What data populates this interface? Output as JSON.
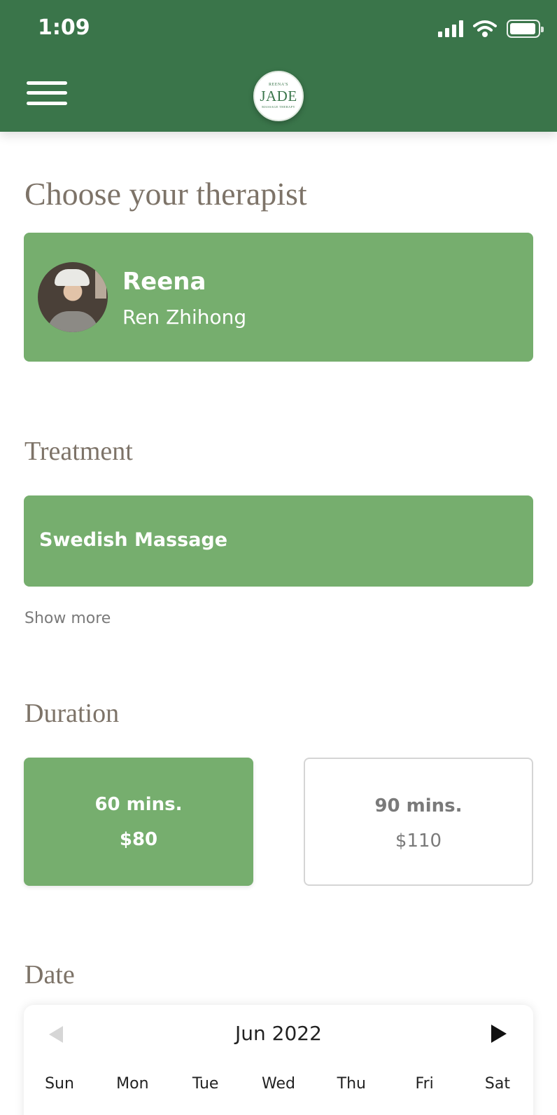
{
  "status_bar": {
    "time": "1:09"
  },
  "header": {
    "logo": {
      "top_text": "REENA'S",
      "main_text": "JADE",
      "bottom_text": "MASSAGE THERAPY"
    }
  },
  "therapist": {
    "title": "Choose your therapist",
    "name": "Reena",
    "subtitle": "Ren Zhihong"
  },
  "treatment": {
    "title": "Treatment",
    "selected": "Swedish Massage",
    "show_more": "Show more"
  },
  "duration": {
    "title": "Duration",
    "options": [
      {
        "mins": "60 mins.",
        "price": "$80",
        "selected": true
      },
      {
        "mins": "90 mins.",
        "price": "$110",
        "selected": false
      }
    ]
  },
  "date": {
    "title": "Date",
    "month": "Jun 2022",
    "weekdays": [
      "Sun",
      "Mon",
      "Tue",
      "Wed",
      "Thu",
      "Fri",
      "Sat"
    ]
  },
  "colors": {
    "header_green": "#3a754a",
    "selection_green": "#76ae6e",
    "title_taupe": "#7d7368"
  }
}
